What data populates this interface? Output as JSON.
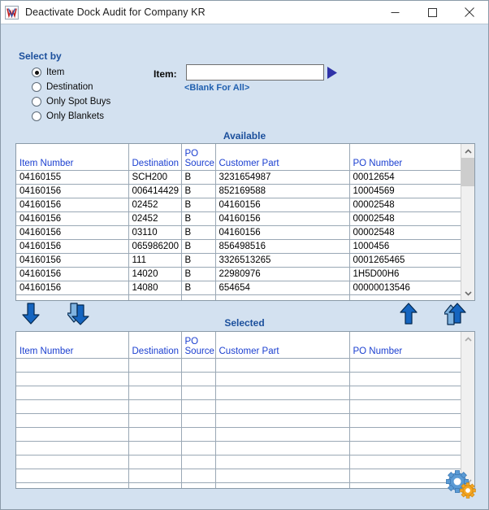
{
  "window": {
    "title": "Deactivate Dock Audit for Company KR",
    "app_icon": "w-app-icon",
    "controls": {
      "minimize": "minimize-icon",
      "maximize": "maximize-icon",
      "close": "close-icon"
    }
  },
  "colors": {
    "dialog_background": "#d3e1f0",
    "heading_blue": "#1b4f9c",
    "grid_header_blue": "#1b3fd0",
    "link_blue": "#2060b0",
    "arrow_blue": "#1565c0",
    "titlebar_background": "#ffffff"
  },
  "select_by": {
    "legend": "Select by",
    "selected": "Item",
    "options": [
      {
        "label": "Item",
        "checked": true
      },
      {
        "label": "Destination",
        "checked": false
      },
      {
        "label": "Only Spot Buys",
        "checked": false
      },
      {
        "label": "Only Blankets",
        "checked": false
      }
    ]
  },
  "item_filter": {
    "label": "Item:",
    "value": "",
    "placeholder": "",
    "go_icon": "play-triangle-icon",
    "hint": "<Blank For All>"
  },
  "available": {
    "caption": "Available",
    "columns": [
      "Item Number",
      "Destination",
      "PO\nSource",
      "Customer Part",
      "PO Number"
    ],
    "rows": [
      [
        "04160155",
        "SCH200",
        "B",
        "3231654987",
        "00012654"
      ],
      [
        "04160156",
        "006414429",
        "B",
        "852169588",
        "10004569"
      ],
      [
        "04160156",
        "02452",
        "B",
        "04160156",
        "00002548"
      ],
      [
        "04160156",
        "02452",
        "B",
        "04160156",
        "00002548"
      ],
      [
        "04160156",
        "03110",
        "B",
        "04160156",
        "00002548"
      ],
      [
        "04160156",
        "065986200",
        "B",
        "856498516",
        "1000456"
      ],
      [
        "04160156",
        "111",
        "B",
        "3326513265",
        "0001265465"
      ],
      [
        "04160156",
        "14020",
        "B",
        "22980976",
        "1H5D00H6"
      ],
      [
        "04160156",
        "14080",
        "B",
        "654654",
        "00000013546"
      ],
      [
        "",
        "",
        "",
        "",
        ""
      ]
    ],
    "scrollbar": {
      "up": "scroll-up-icon",
      "down": "scroll-down-icon",
      "thumb_top_pct": 0,
      "thumb_height_pct": 22
    }
  },
  "selected": {
    "caption": "Selected",
    "columns": [
      "Item Number",
      "Destination",
      "PO\nSource",
      "Customer Part",
      "PO Number"
    ],
    "rows": [
      [
        "",
        "",
        "",
        "",
        ""
      ],
      [
        "",
        "",
        "",
        "",
        ""
      ],
      [
        "",
        "",
        "",
        "",
        ""
      ],
      [
        "",
        "",
        "",
        "",
        ""
      ],
      [
        "",
        "",
        "",
        "",
        ""
      ],
      [
        "",
        "",
        "",
        "",
        ""
      ],
      [
        "",
        "",
        "",
        "",
        ""
      ],
      [
        "",
        "",
        "",
        "",
        ""
      ],
      [
        "",
        "",
        "",
        "",
        ""
      ],
      [
        "",
        "",
        "",
        "",
        ""
      ]
    ],
    "scrollbar": {
      "up": "scroll-up-icon",
      "down": "scroll-down-icon",
      "thumb_top_pct": 0,
      "thumb_height_pct": 0
    }
  },
  "transfer_buttons": [
    {
      "name": "move-down-button",
      "icon": "arrow-down-icon"
    },
    {
      "name": "move-down-all-button",
      "icon": "arrow-down-double-icon"
    },
    {
      "name": "move-up-button",
      "icon": "arrow-up-icon"
    },
    {
      "name": "move-up-all-button",
      "icon": "arrow-up-double-icon"
    }
  ],
  "settings": {
    "icon": "gears-settings-icon"
  }
}
